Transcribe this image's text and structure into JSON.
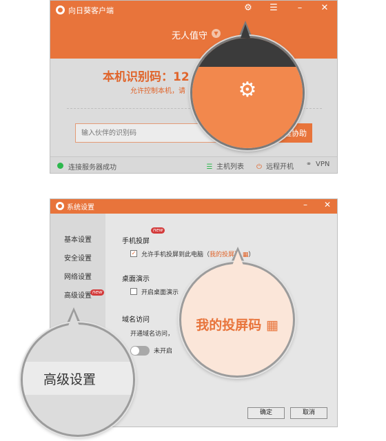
{
  "main_window": {
    "title": "向日葵客户端",
    "mode_label": "无人值守",
    "id_label": "本机识别码：12",
    "allow_text": "允许控制本机，请",
    "partner_placeholder": "输入伙伴的识别码",
    "connect_label": "远程协助",
    "status": "连接服务器成功",
    "host_list": "主机列表",
    "remote_boot": "远程开机",
    "vpn": "VPN"
  },
  "settings_window": {
    "title": "系统设置",
    "sidebar": [
      "基本设置",
      "安全设置",
      "网络设置",
      "高级设置"
    ],
    "new_badge": "new",
    "screen_cast": {
      "title": "手机投屏",
      "option_prefix": "允许手机投屏到此电脑（",
      "option_link": "我的投屏码",
      "option_suffix": "）",
      "checked": true
    },
    "desktop_demo": {
      "title": "桌面演示",
      "option": "开启桌面演示",
      "checked": false
    },
    "domain_access": {
      "title": "域名访问",
      "desc": "开通域名访问，",
      "toggle_label": "未开启",
      "enabled": false
    },
    "ok_label": "确定",
    "cancel_label": "取消"
  },
  "callouts": {
    "screen_code": "我的投屏码",
    "advanced": "高级设置"
  },
  "colors": {
    "accent": "#e8743b",
    "accent_text": "#e0642a",
    "status_ok": "#2db84d"
  },
  "icons": [
    "gear-icon",
    "menu-icon",
    "minimize-icon",
    "close-icon",
    "chevron-down-icon",
    "list-icon",
    "power-icon",
    "vpn-icon",
    "qr-icon",
    "check-icon"
  ]
}
